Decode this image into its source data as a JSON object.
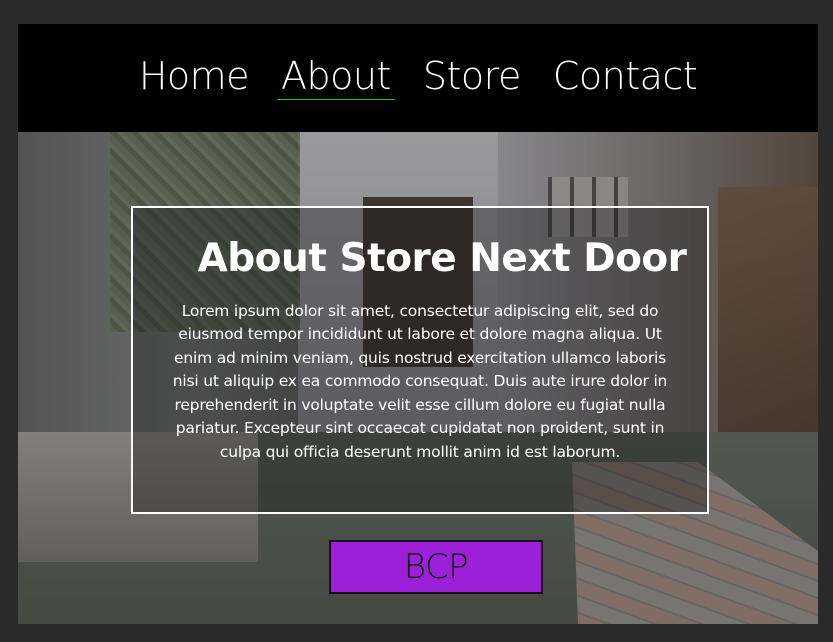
{
  "nav": {
    "items": [
      {
        "label": "Home",
        "active": false
      },
      {
        "label": "About",
        "active": true
      },
      {
        "label": "Store",
        "active": false
      },
      {
        "label": "Contact",
        "active": false
      }
    ],
    "active_underline_color": "#22c922"
  },
  "hero": {
    "background": "store-interior-photo",
    "title": "About Store Next Door",
    "body": "Lorem ipsum dolor sit amet, consectetur adipiscing elit, sed do eiusmod tempor incididunt ut labore et dolore magna aliqua. Ut enim ad minim veniam, quis nostrud exercitation ullamco laboris nisi ut aliquip ex ea commodo consequat. Duis aute irure dolor in reprehenderit in voluptate velit esse cillum dolore eu fugiat nulla pariatur. Excepteur sint occaecat cupidatat non proident, sunt in culpa qui officia deserunt mollit anim id est laborum.",
    "button_label": "BCP",
    "button_color": "#9b20d8"
  }
}
